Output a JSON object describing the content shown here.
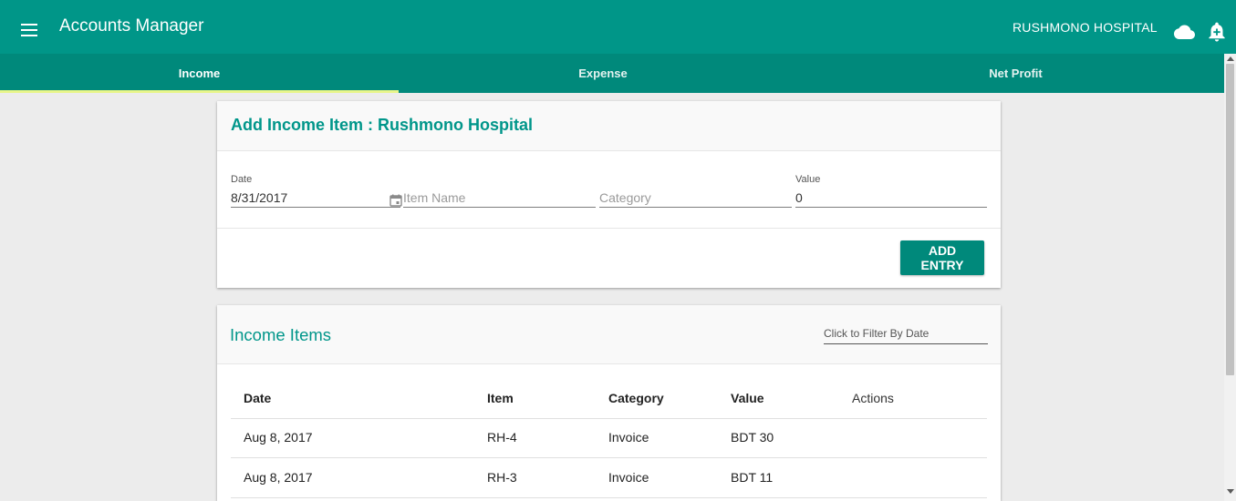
{
  "app": {
    "title": "Accounts Manager",
    "organization": "RUSHMONO HOSPITAL"
  },
  "icons": {
    "menu": "menu-icon",
    "cloud": "cloud-icon",
    "bell": "notification-bell-icon",
    "calendar": "calendar-icon"
  },
  "colors": {
    "primary": "#009688",
    "tab_bar": "#00897b",
    "accent_indicator": "#e8f58a",
    "title_teal": "#00968a"
  },
  "tabs": [
    {
      "label": "Income",
      "active": true
    },
    {
      "label": "Expense",
      "active": false
    },
    {
      "label": "Net Profit",
      "active": false
    }
  ],
  "add_form": {
    "title": "Add Income Item : Rushmono Hospital",
    "date_label": "Date",
    "date_value": "8/31/2017",
    "item_name_placeholder": "Item Name",
    "category_placeholder": "Category",
    "value_label": "Value",
    "value_value": "0",
    "add_button": "ADD ENTRY"
  },
  "income_list": {
    "title": "Income Items",
    "filter_placeholder": "Click to Filter By Date",
    "columns": [
      "Date",
      "Item",
      "Category",
      "Value",
      "Actions"
    ],
    "rows": [
      {
        "date": "Aug 8, 2017",
        "item": "RH-4",
        "category": "Invoice",
        "value": "BDT 30"
      },
      {
        "date": "Aug 8, 2017",
        "item": "RH-3",
        "category": "Invoice",
        "value": "BDT 11"
      }
    ]
  }
}
